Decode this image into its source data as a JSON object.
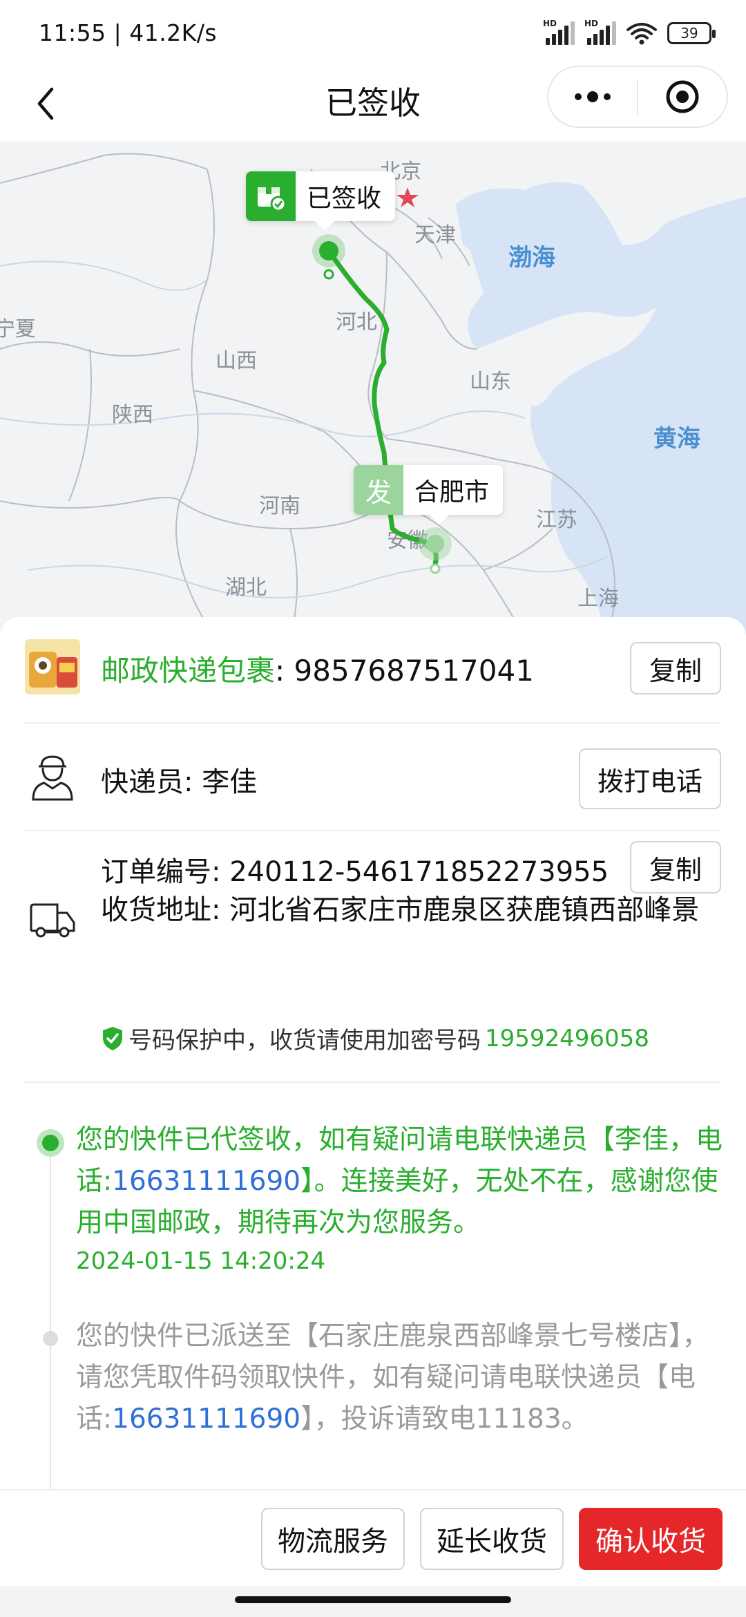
{
  "status_bar": {
    "time": "11:55 | 41.2K/s",
    "signal_label_1": "HD",
    "signal_label_2": "HD",
    "battery": "39"
  },
  "nav": {
    "title": "已签收"
  },
  "map": {
    "labels": {
      "beijing": "北京",
      "tianjin": "天津",
      "bohai": "渤海",
      "ningxia": "宁夏",
      "hebei": "河北",
      "shanxi": "山西",
      "shandong": "山东",
      "shaanxi": "陕西",
      "huanghai": "黄海",
      "henan": "河南",
      "jiangsu": "江苏",
      "anhui": "安徽",
      "hubei": "湖北",
      "shanghai": "上海"
    },
    "dest_bubble": "已签收",
    "origin_tag": "发",
    "origin_bubble": "合肥市",
    "colors": {
      "route": "#2aae2e",
      "land": "#f2f3f5",
      "sea": "#d6e4f5"
    }
  },
  "package": {
    "carrier": "邮政快递包裹",
    "colon": ": ",
    "tracking_number": "9857687517041",
    "copy_label": "复制"
  },
  "courier": {
    "label": "快递员: 李佳",
    "call_label": "拨打电话"
  },
  "order": {
    "order_number_line": "订单编号: 240112-546171852273955",
    "copy_label": "复制",
    "address_line": "收货地址: 河北省石家庄市鹿泉区获鹿镇西部峰景",
    "privacy_text": "号码保护中，收货请使用加密号码",
    "privacy_number": "19592496058"
  },
  "timeline": [
    {
      "text_before": "您的快件已代签收，如有疑问请电联快递员【李佳，电话:",
      "phone": "16631111690",
      "text_after": "】。连接美好，无处不在，感谢您使用中国邮政，期待再次为您服务。",
      "time": "2024-01-15 14:20:24"
    },
    {
      "text_before": "您的快件已派送至【石家庄鹿泉西部峰景七号楼店】，请您凭取件码领取快件，如有疑问请电联快递员【电话:",
      "phone": "16631111690",
      "text_after": "】，投诉请致电11183。"
    }
  ],
  "actions": {
    "logistics_service": "物流服务",
    "extend_receipt": "延长收货",
    "confirm_receipt": "确认收货"
  },
  "accent_colors": {
    "green": "#2aae2e",
    "red": "#e5272a",
    "blue": "#2f6fd6"
  }
}
